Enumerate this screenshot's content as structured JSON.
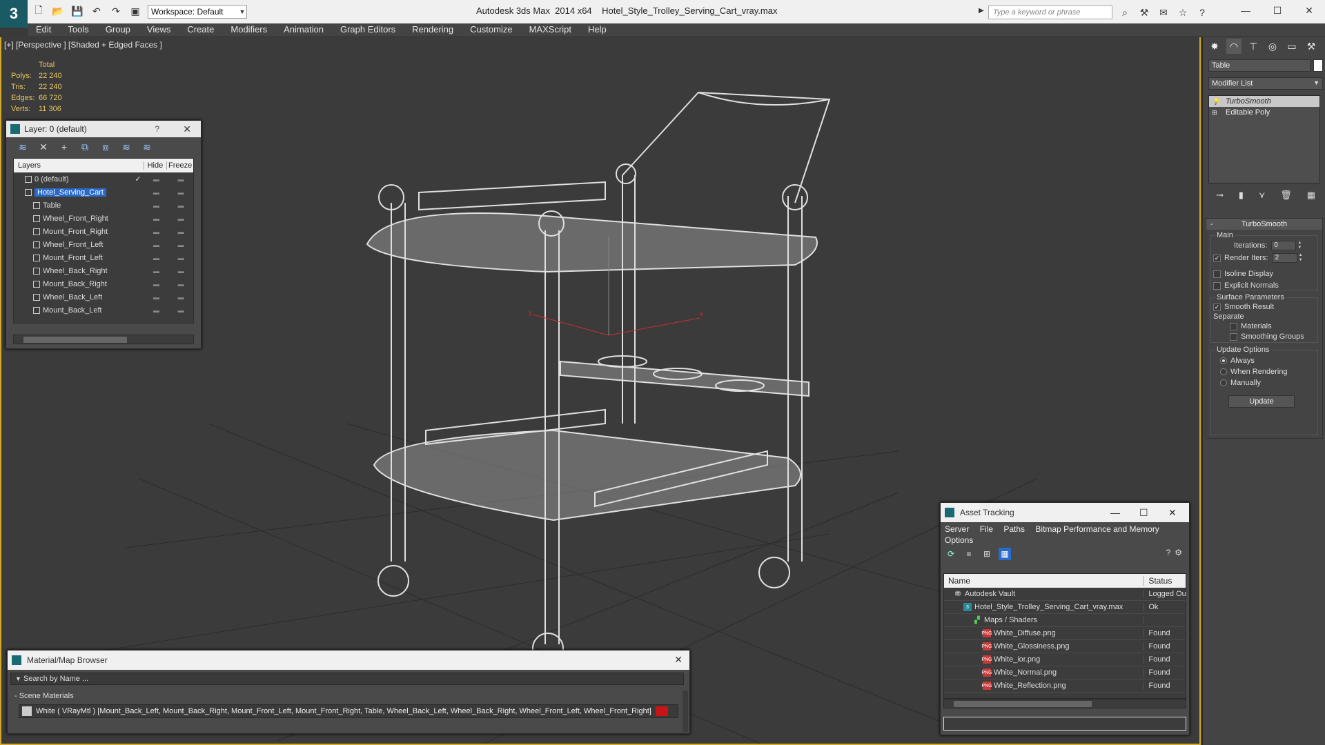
{
  "titlebar": {
    "logo": "3",
    "app_title": "Autodesk 3ds Max  2014 x64",
    "file_title": "Hotel_Style_Trolley_Serving_Cart_vray.max",
    "workspace": "Workspace: Default",
    "search_placeholder": "Type a keyword or phrase"
  },
  "menu": [
    "Edit",
    "Tools",
    "Group",
    "Views",
    "Create",
    "Modifiers",
    "Animation",
    "Graph Editors",
    "Rendering",
    "Customize",
    "MAXScript",
    "Help"
  ],
  "viewport": {
    "label": "[+] [Perspective ] [Shaded + Edged Faces ]",
    "stats": {
      "header": "Total",
      "rows": [
        {
          "k": "Polys:",
          "v": "22 240"
        },
        {
          "k": "Tris:",
          "v": "22 240"
        },
        {
          "k": "Edges:",
          "v": "66 720"
        },
        {
          "k": "Verts:",
          "v": "11 306"
        }
      ]
    },
    "axis_x": "x",
    "axis_y": "y"
  },
  "layer_panel": {
    "title": "Layer: 0 (default)",
    "help": "?",
    "columns": {
      "layers": "Layers",
      "hide": "Hide",
      "freeze": "Freeze"
    },
    "rows": [
      {
        "name": "0 (default)",
        "indent": 1,
        "check": "✓"
      },
      {
        "name": "Hotel_Serving_Cart",
        "indent": 1,
        "selected": true
      },
      {
        "name": "Table",
        "indent": 2
      },
      {
        "name": "Wheel_Front_Right",
        "indent": 2
      },
      {
        "name": "Mount_Front_Right",
        "indent": 2
      },
      {
        "name": "Wheel_Front_Left",
        "indent": 2
      },
      {
        "name": "Mount_Front_Left",
        "indent": 2
      },
      {
        "name": "Wheel_Back_Right",
        "indent": 2
      },
      {
        "name": "Mount_Back_Right",
        "indent": 2
      },
      {
        "name": "Wheel_Back_Left",
        "indent": 2
      },
      {
        "name": "Mount_Back_Left",
        "indent": 2
      }
    ]
  },
  "command_panel": {
    "object_name": "Table",
    "modifier_list": "Modifier List",
    "stack": [
      {
        "label": "TurboSmooth",
        "selected": true
      },
      {
        "label": "Editable Poly",
        "selected": false
      }
    ],
    "rollout": {
      "title": "TurboSmooth",
      "main_label": "Main",
      "iterations_label": "Iterations:",
      "iterations_value": "0",
      "render_iters_label": "Render Iters:",
      "render_iters_value": "2",
      "isoline": "Isoline Display",
      "explicit_normals": "Explicit Normals",
      "surface_params": "Surface Parameters",
      "smooth_result": "Smooth Result",
      "separate": "Separate",
      "materials": "Materials",
      "smoothing_groups": "Smoothing Groups",
      "update_options": "Update Options",
      "always": "Always",
      "when_rendering": "When Rendering",
      "manually": "Manually",
      "update_btn": "Update"
    }
  },
  "asset_tracking": {
    "title": "Asset Tracking",
    "menu": [
      "Server",
      "File",
      "Paths",
      "Bitmap Performance and Memory",
      "Options"
    ],
    "columns": {
      "name": "Name",
      "status": "Status"
    },
    "rows": [
      {
        "name": "Autodesk Vault",
        "status": "Logged Ou",
        "icon": "vault",
        "indent": 1
      },
      {
        "name": "Hotel_Style_Trolley_Serving_Cart_vray.max",
        "status": "Ok",
        "icon": "max",
        "indent": 2
      },
      {
        "name": "Maps / Shaders",
        "status": "",
        "icon": "maps",
        "indent": 3
      },
      {
        "name": "White_Diffuse.png",
        "status": "Found",
        "icon": "png",
        "indent": 4
      },
      {
        "name": "White_Glossiness.png",
        "status": "Found",
        "icon": "png",
        "indent": 4
      },
      {
        "name": "White_ior.png",
        "status": "Found",
        "icon": "png",
        "indent": 4
      },
      {
        "name": "White_Normal.png",
        "status": "Found",
        "icon": "png",
        "indent": 4
      },
      {
        "name": "White_Reflection.png",
        "status": "Found",
        "icon": "png",
        "indent": 4
      }
    ]
  },
  "material_browser": {
    "title": "Material/Map Browser",
    "search_placeholder": "Search by Name ...",
    "section": "- Scene Materials",
    "material_row": "White ( VRayMtl ) [Mount_Back_Left, Mount_Back_Right, Mount_Front_Left, Mount_Front_Right, Table, Wheel_Back_Left, Wheel_Back_Right, Wheel_Front_Left, Wheel_Front_Right]"
  },
  "colors": {
    "viewport_border": "#d4a82a",
    "stats_text": "#e8c760",
    "selection": "#2a6ac8",
    "png_icon": "#c83a3a"
  }
}
